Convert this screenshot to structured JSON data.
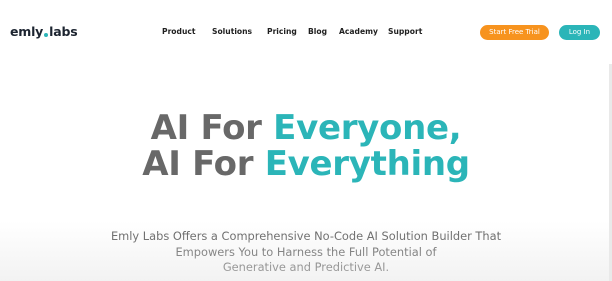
{
  "logo": {
    "part1": "emly",
    "part2": "labs",
    "dot_color": "#2bb5b8"
  },
  "nav": {
    "items": [
      {
        "label": "Product"
      },
      {
        "label": "Solutions"
      },
      {
        "label": "Pricing"
      },
      {
        "label": "Blog"
      },
      {
        "label": "Academy"
      },
      {
        "label": "Support"
      }
    ],
    "trial_label": "Start Free Trial",
    "login_label": "Log In"
  },
  "hero": {
    "line1_prefix": "AI For",
    "line1_highlight": "Everyone,",
    "line2_prefix": "AI For",
    "line2_highlight": "Everything",
    "subtitle_lines": [
      "Emly Labs Offers a Comprehensive No-Code AI Solution Builder That",
      "Empowers You to Harness the Full Potential of",
      "Generative and Predictive AI."
    ]
  },
  "colors": {
    "teal": "#2bb5b8",
    "orange": "#f7931e",
    "grey_text": "#686868"
  }
}
